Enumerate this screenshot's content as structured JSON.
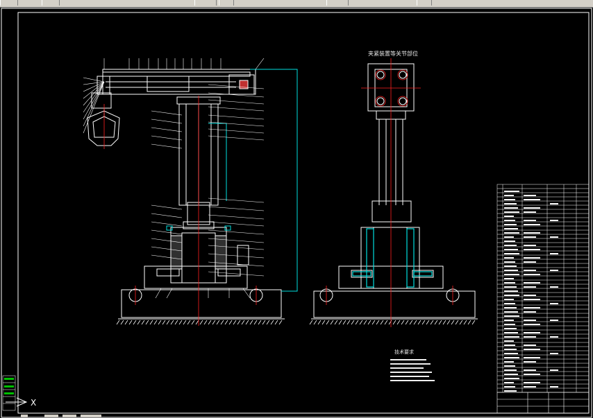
{
  "window": {
    "title": ""
  },
  "toolbar": {
    "buttons": [
      "back-button",
      "forward-button",
      "undo-button",
      "redo-button",
      "layers-button",
      "properties-button"
    ]
  },
  "drawing": {
    "side_view_title": "夹紧装置等关节部位",
    "tech_requirements_title": "技术要求",
    "ucs_label": "X"
  },
  "colors": {
    "background": "#000000",
    "lines": "#ffffff",
    "center_lines": "#ff2020",
    "cyan": "#00e0e0",
    "green": "#00c000",
    "titleblock_fill": "#ffffff"
  }
}
